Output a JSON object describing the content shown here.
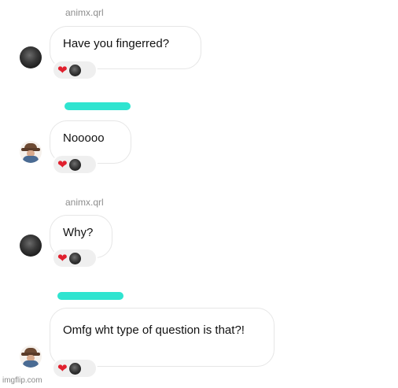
{
  "messages": [
    {
      "sender": "animx.qrl",
      "text": "Have you fingerred?",
      "reactions": [
        "heart-icon",
        "reactor-avatar"
      ]
    },
    {
      "sender_redacted": true,
      "text": "Nooooo",
      "reactions": [
        "heart-icon",
        "reactor-avatar"
      ]
    },
    {
      "sender": "animx.qrl",
      "text": "Why?",
      "reactions": [
        "heart-icon",
        "reactor-avatar"
      ]
    },
    {
      "sender_redacted": true,
      "text": "Omfg wht type of question is that?!",
      "reactions": [
        "heart-icon",
        "reactor-avatar"
      ]
    }
  ],
  "reaction_heart": "❤",
  "colors": {
    "heart": "#e0202e",
    "redaction": "#2fe4d0",
    "bubble_border": "#e6e6e6",
    "username": "#8e8e8e"
  },
  "watermark": "imgflip.com"
}
